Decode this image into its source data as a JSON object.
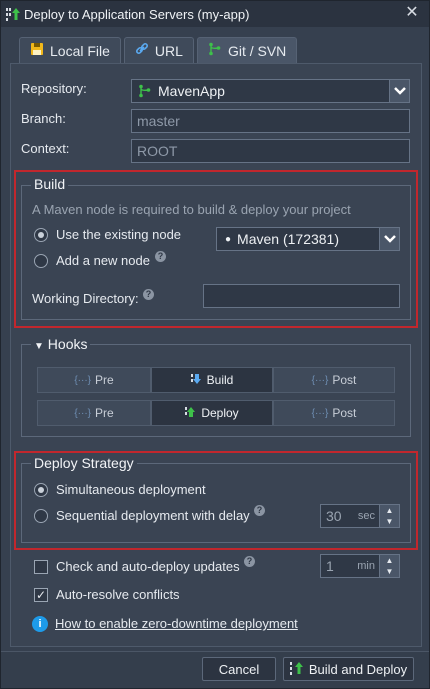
{
  "window": {
    "title": "Deploy to Application Servers (my-app)",
    "close_glyph": "✕"
  },
  "tabs": [
    {
      "label": "Local File",
      "icon": "file-icon"
    },
    {
      "label": "URL",
      "icon": "link-icon"
    },
    {
      "label": "Git / SVN",
      "icon": "git-icon",
      "active": true
    }
  ],
  "source": {
    "repository_label": "Repository:",
    "repository_value": "MavenApp",
    "branch_label": "Branch:",
    "branch_placeholder": "master",
    "context_label": "Context:",
    "context_placeholder": "ROOT"
  },
  "build": {
    "legend": "Build",
    "hint": "A Maven node is required to build & deploy your project",
    "use_existing_label": "Use the existing node",
    "add_new_label": "Add a new node",
    "node_value": "Maven (172381)",
    "working_dir_label": "Working Directory:",
    "working_dir_value": ""
  },
  "hooks": {
    "legend": "Hooks",
    "rows": [
      {
        "pre": "Pre",
        "main": "Build",
        "post": "Post"
      },
      {
        "pre": "Pre",
        "main": "Deploy",
        "post": "Post"
      }
    ]
  },
  "deploy_strategy": {
    "legend": "Deploy Strategy",
    "simultaneous_label": "Simultaneous deployment",
    "sequential_label": "Sequential deployment with delay",
    "delay_value": "30",
    "delay_unit": "sec"
  },
  "options": {
    "auto_deploy_label": "Check and auto-deploy updates",
    "interval_value": "1",
    "interval_unit": "min",
    "auto_resolve_label": "Auto-resolve conflicts",
    "zero_downtime_link": "How to enable zero-downtime deployment"
  },
  "footer": {
    "cancel_label": "Cancel",
    "build_deploy_label": "Build and Deploy"
  },
  "colors": {
    "highlight_border": "#c1272d",
    "accent_green": "#3ec14a",
    "info_blue": "#1e9be9"
  }
}
